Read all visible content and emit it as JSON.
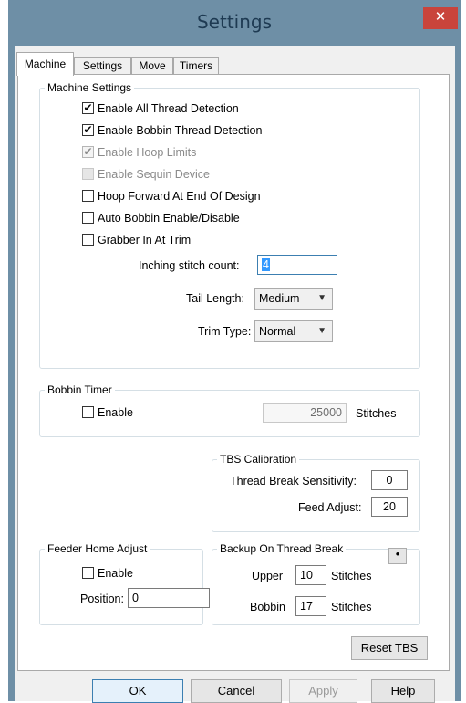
{
  "window": {
    "title": "Settings",
    "close_glyph": "✕"
  },
  "tabs": [
    "Machine",
    "Settings",
    "Move",
    "Timers"
  ],
  "machine_settings": {
    "legend": "Machine Settings",
    "checkboxes": [
      {
        "label": "Enable All Thread Detection",
        "checked": true,
        "enabled": true
      },
      {
        "label": "Enable Bobbin Thread Detection",
        "checked": true,
        "enabled": true
      },
      {
        "label": "Enable Hoop Limits",
        "checked": true,
        "enabled": false
      },
      {
        "label": "Enable Sequin Device",
        "checked": false,
        "enabled": false
      },
      {
        "label": "Hoop Forward At End Of Design",
        "checked": false,
        "enabled": true
      },
      {
        "label": "Auto Bobbin Enable/Disable",
        "checked": false,
        "enabled": true
      },
      {
        "label": "Grabber In At Trim",
        "checked": false,
        "enabled": true
      }
    ],
    "inching_label": "Inching stitch count:",
    "inching_value": "4",
    "tail_length_label": "Tail Length:",
    "tail_length_value": "Medium",
    "trim_type_label": "Trim Type:",
    "trim_type_value": "Normal",
    "check_glyph": "✔",
    "dropdown_glyph": "▼"
  },
  "bobbin_timer": {
    "legend": "Bobbin Timer",
    "enable_label": "Enable",
    "enable_checked": false,
    "stitches_value": "25000",
    "stitches_label": "Stitches"
  },
  "tbs_calibration": {
    "legend": "TBS Calibration",
    "sensitivity_label": "Thread Break Sensitivity:",
    "sensitivity_value": "0",
    "feed_adjust_label": "Feed Adjust:",
    "feed_adjust_value": "20"
  },
  "feeder_home_adjust": {
    "legend": "Feeder Home Adjust",
    "enable_label": "Enable",
    "enable_checked": false,
    "position_label": "Position:",
    "position_value": "0"
  },
  "backup_on_thread_break": {
    "legend": "Backup On Thread Break",
    "small_button_glyph": "•",
    "upper_label": "Upper",
    "upper_value": "10",
    "upper_unit": "Stitches",
    "bobbin_label": "Bobbin",
    "bobbin_value": "17",
    "bobbin_unit": "Stitches"
  },
  "reset_tbs_label": "Reset TBS",
  "footer_buttons": {
    "ok": "OK",
    "cancel": "Cancel",
    "apply": "Apply",
    "help": "Help"
  },
  "colors": {
    "title_bar": "#6e8fa6",
    "close_button": "#c9443b",
    "focus_border": "#3c7fb1"
  }
}
